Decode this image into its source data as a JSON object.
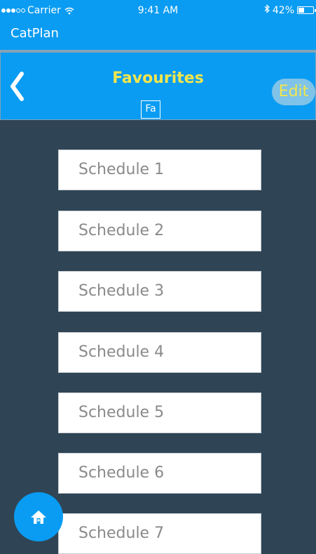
{
  "status_bar": {
    "carrier": "Carrier",
    "time": "9:41 AM",
    "battery_text": "42%",
    "battery_level": 0.42
  },
  "app": {
    "title": "CatPlan"
  },
  "header": {
    "title": "Favourites",
    "badge": "Fa",
    "edit_label": "Edit"
  },
  "schedules": [
    {
      "label": "Schedule 1"
    },
    {
      "label": "Schedule 2"
    },
    {
      "label": "Schedule 3"
    },
    {
      "label": "Schedule 4"
    },
    {
      "label": "Schedule 5"
    },
    {
      "label": "Schedule 6"
    },
    {
      "label": "Schedule 7"
    }
  ],
  "icons": {
    "back": "chevron-left-icon",
    "home": "home-icon",
    "wifi": "wifi-icon",
    "bluetooth": "bluetooth-icon",
    "battery": "battery-icon"
  },
  "colors": {
    "primary": "#0a9cf2",
    "background": "#2f4556",
    "title": "#f2e64c",
    "edit_bg": "#7fc3e8",
    "item_text": "#8a8a8a"
  }
}
